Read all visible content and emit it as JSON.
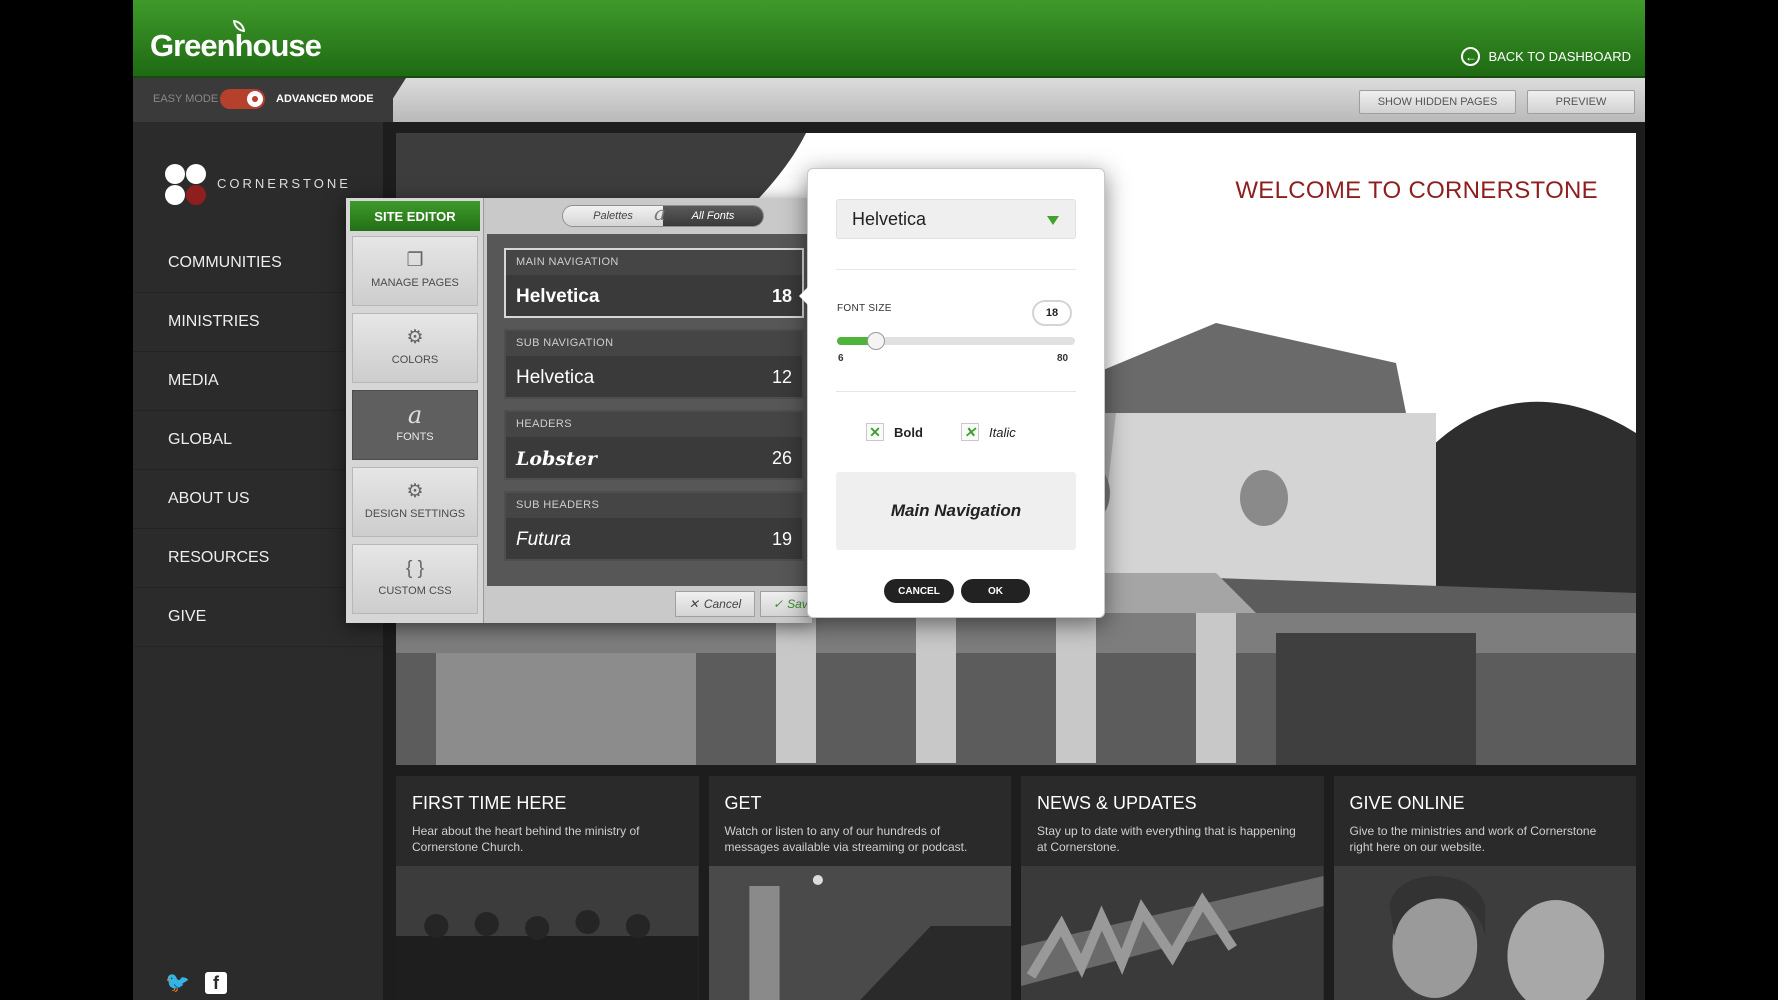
{
  "app": {
    "logo": "Greenhouse",
    "back_to_dashboard": "BACK TO DASHBOARD"
  },
  "modebar": {
    "easy_mode": "EASY MODE",
    "advanced_mode": "ADVANCED MODE",
    "show_hidden_pages": "SHOW HIDDEN PAGES",
    "preview": "PREVIEW"
  },
  "site": {
    "name": "CORNERSTONE",
    "nav": [
      "COMMUNITIES",
      "MINISTRIES",
      "MEDIA",
      "GLOBAL",
      "ABOUT US",
      "RESOURCES",
      "GIVE"
    ],
    "welcome": "WELCOME TO CORNERSTONE",
    "cards": [
      {
        "title": "FIRST TIME HERE",
        "desc": "Hear about the heart behind the ministry of Cornerstone Church."
      },
      {
        "title": "GET",
        "desc": "Watch or listen to any of our hundreds of messages available via streaming or podcast."
      },
      {
        "title": "NEWS & UPDATES",
        "desc": "Stay up to date with everything that is happening at Cornerstone."
      },
      {
        "title": "GIVE ONLINE",
        "desc": "Give to the ministries and work of Cornerstone right here on our website."
      }
    ]
  },
  "editor": {
    "title": "SITE EDITOR",
    "tabs": [
      {
        "label": "MANAGE PAGES",
        "icon": "pages-icon"
      },
      {
        "label": "COLORS",
        "icon": "gear-icon"
      },
      {
        "label": "FONTS",
        "icon": "font-icon"
      },
      {
        "label": "DESIGN SETTINGS",
        "icon": "gear-icon"
      },
      {
        "label": "CUSTOM CSS",
        "icon": "braces-icon"
      }
    ],
    "active_tab": "FONTS",
    "palettes": "Palettes",
    "font_glyph": "a",
    "all_fonts": "All Fonts",
    "fonts": [
      {
        "label": "MAIN NAVIGATION",
        "font": "Helvetica",
        "size": "18"
      },
      {
        "label": "SUB NAVIGATION",
        "font": "Helvetica",
        "size": "12"
      },
      {
        "label": "HEADERS",
        "font": "Lobster",
        "size": "26"
      },
      {
        "label": "SUB HEADERS",
        "font": "Futura",
        "size": "19"
      }
    ],
    "cancel": "Cancel",
    "save": "Save"
  },
  "popup": {
    "font": "Helvetica",
    "font_size_label": "FONT SIZE",
    "font_size": "18",
    "slider": {
      "min": 6,
      "max": 80,
      "value": 18,
      "min_label": "6",
      "max_label": "80"
    },
    "bold_label": "Bold",
    "italic_label": "Italic",
    "bold_checked": true,
    "italic_checked": true,
    "preview_text": "Main Navigation",
    "cancel": "CANCEL",
    "ok": "OK"
  },
  "colors": {
    "brand_green": "#2f8a1f",
    "accent_red": "#8f1e1e",
    "toggle_red": "#b5402c"
  }
}
